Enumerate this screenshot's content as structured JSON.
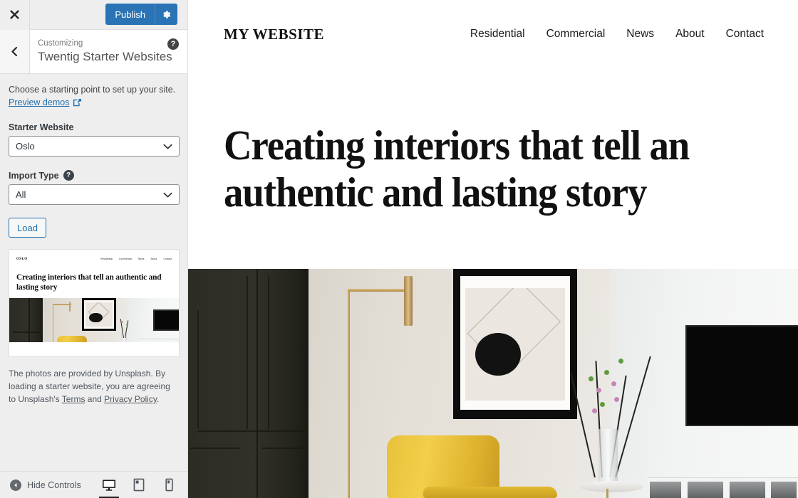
{
  "customizer": {
    "close_icon": "close-icon",
    "publish_label": "Publish",
    "publish_gear_icon": "gear-icon",
    "back_icon": "chevron-left-icon",
    "subtitle": "Customizing",
    "title": "Twentig Starter Websites",
    "panel_help_icon": "help-circle-icon",
    "intro_text": "Choose a starting point to set up your site.",
    "preview_demos_label": "Preview demos",
    "preview_demos_icon": "external-link-icon",
    "starter_website": {
      "label": "Starter Website",
      "value": "Oslo",
      "options": [
        "Oslo"
      ],
      "chevron_icon": "chevron-down-icon"
    },
    "import_type": {
      "label": "Import Type",
      "help_icon": "help-circle-icon",
      "value": "All",
      "options": [
        "All"
      ],
      "chevron_icon": "chevron-down-icon"
    },
    "load_label": "Load",
    "thumbnail": {
      "logo": "OSLO",
      "nav": [
        "Residential",
        "Commercial",
        "News",
        "About",
        "Contact"
      ],
      "heading": "Creating interiors that tell an authentic and lasting story"
    },
    "footnote": {
      "part1": "The photos are provided by Unsplash. By loading a starter website, you are agreeing to Unsplash's ",
      "terms_label": "Terms",
      "part2": " and ",
      "privacy_label": "Privacy Policy",
      "part3": "."
    },
    "footer": {
      "hide_controls_label": "Hide Controls",
      "collapse_icon": "collapse-left-icon",
      "devices": [
        {
          "name": "desktop",
          "icon": "desktop-icon",
          "active": true
        },
        {
          "name": "tablet",
          "icon": "tablet-icon",
          "active": false
        },
        {
          "name": "mobile",
          "icon": "mobile-icon",
          "active": false
        }
      ]
    },
    "accent_color": "#2a73b5",
    "link_color": "#2271b1"
  },
  "site_preview": {
    "logo": "MY WEBSITE",
    "nav": [
      "Residential",
      "Commercial",
      "News",
      "About",
      "Contact"
    ],
    "hero_heading": "Creating interiors that tell an authentic and lasting story",
    "hero_image_alt": "interior-photo"
  }
}
